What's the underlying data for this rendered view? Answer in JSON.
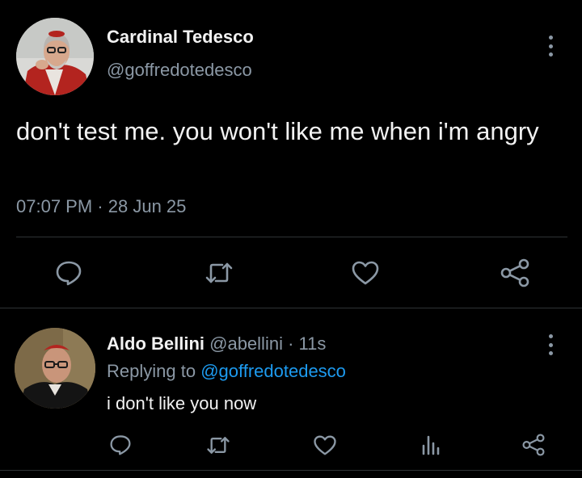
{
  "main_tweet": {
    "author_name": "Cardinal Tedesco",
    "author_handle": "@goffredotedesco",
    "text": "don't test me. you won't like me when i'm angry",
    "time": "07:07 PM",
    "separator": "·",
    "date": "28 Jun 25",
    "actions": [
      "reply-icon",
      "retweet-icon",
      "like-icon",
      "share-icon"
    ]
  },
  "reply_tweet": {
    "author_name": "Aldo Bellini",
    "author_handle": "@abellini",
    "separator": "·",
    "time_ago": "11s",
    "replying_to_label": "Replying to",
    "replying_to_handle": "@goffredotedesco",
    "text": "i don't like you now",
    "actions": [
      "reply-icon",
      "retweet-icon",
      "like-icon",
      "analytics-icon",
      "share-icon"
    ]
  },
  "colors": {
    "background": "#000000",
    "text_primary": "#f2f2f2",
    "text_secondary": "#8b98a5",
    "link": "#1d9bf0",
    "divider": "#2f3336"
  }
}
